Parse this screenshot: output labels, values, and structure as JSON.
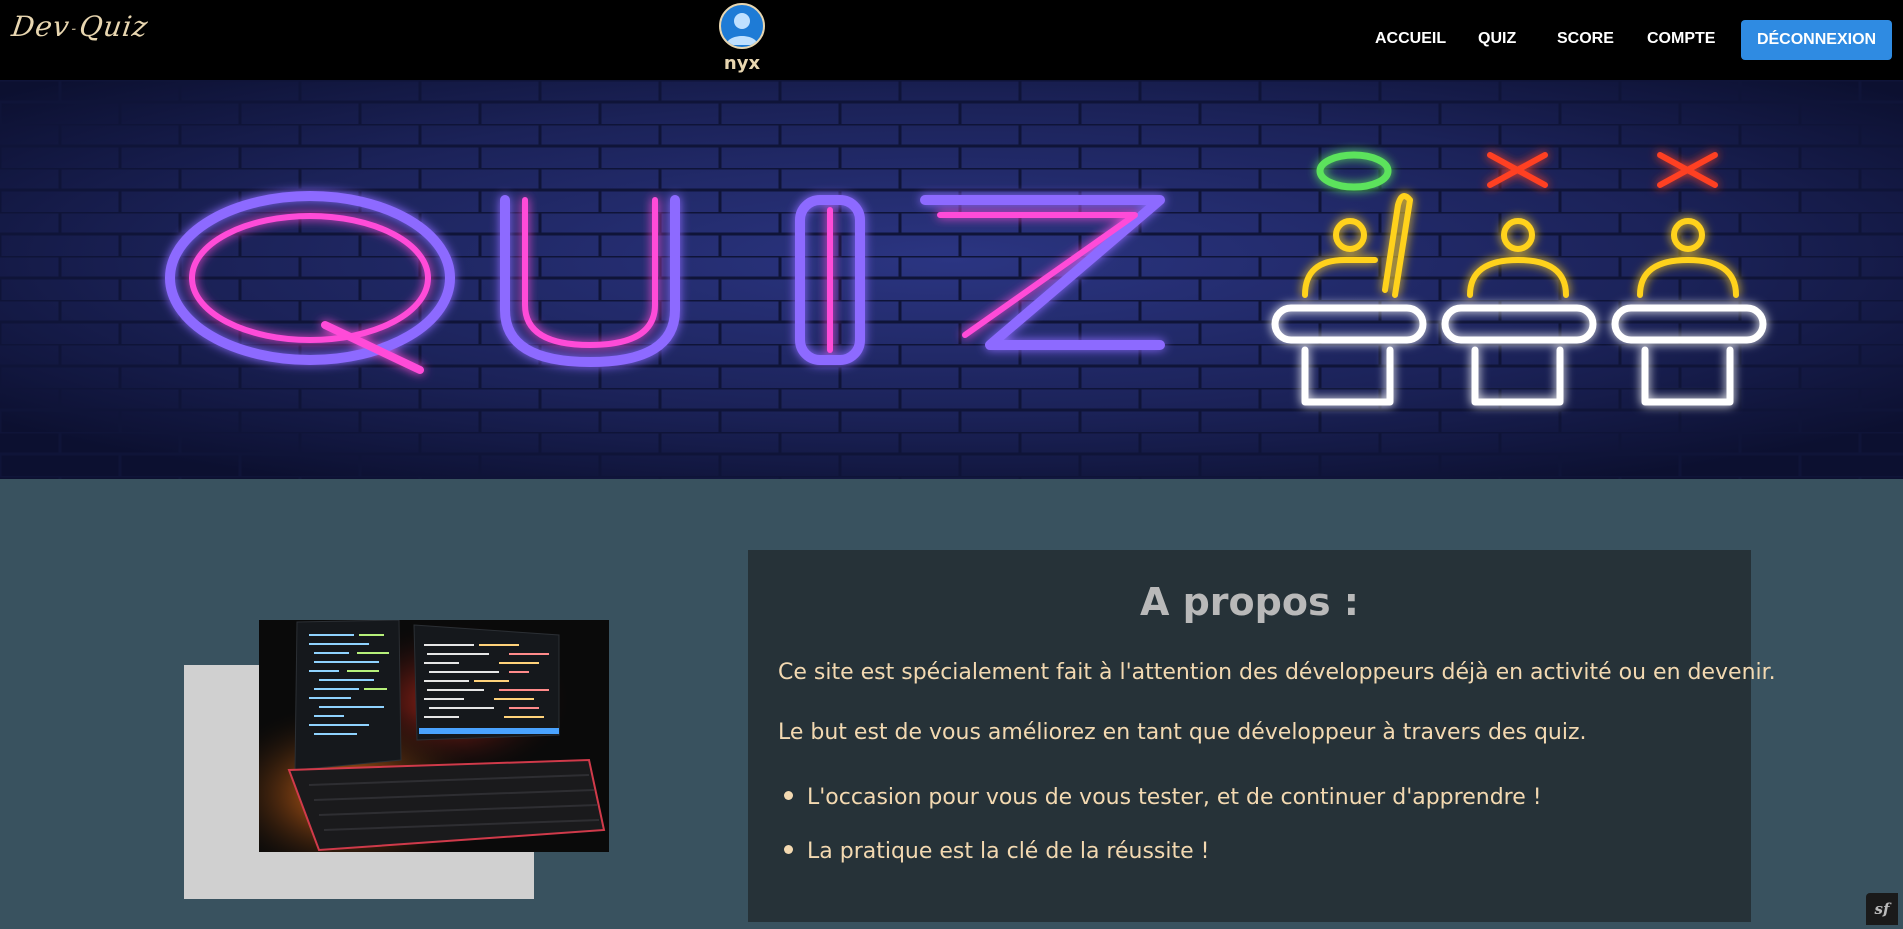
{
  "navbar": {
    "logo_main": "Dev",
    "logo_sep": "-",
    "logo_end": "Quiz",
    "username": "nyx",
    "links": [
      "ACCUEIL",
      "QUIZ",
      "SCORE",
      "COMPTE"
    ],
    "logout_label": "DÉCONNEXION"
  },
  "banner": {
    "neon_word": "QUIZ",
    "marks": [
      "O",
      "X",
      "X"
    ]
  },
  "about": {
    "title": "A propos :",
    "paragraphs": [
      "Ce site est spécialement fait à l'attention des développeurs déjà en activité ou en devenir.",
      "Le but est de vous améliorez en tant que développeur à travers des quiz."
    ],
    "bullets": [
      "L'occasion pour vous de vous tester, et de continuer d'apprendre !",
      "La pratique est la clé de la réussite !"
    ]
  },
  "debug_badge": "sf",
  "colors": {
    "page_bg": "#39525f",
    "card_bg": "#263238",
    "accent": "#2f8be2",
    "cream": "#f3d9b1"
  }
}
